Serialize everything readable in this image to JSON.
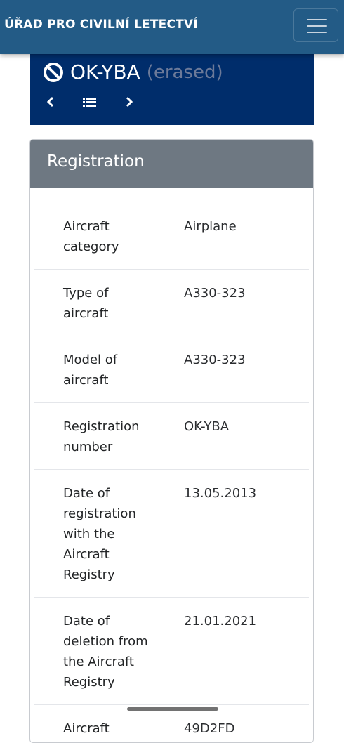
{
  "navbar": {
    "brand": "ÚŘAD PRO CIVILNÍ LETECTVÍ",
    "menu_icon": "hamburger-menu-icon"
  },
  "aircraft": {
    "registration": "OK-YBA",
    "status": "(erased)",
    "status_icon": "prohibited-icon"
  },
  "nav": {
    "prev_icon": "chevron-left-icon",
    "list_icon": "list-icon",
    "next_icon": "chevron-right-icon"
  },
  "registration_card": {
    "title": "Registration",
    "rows": [
      {
        "label": "Aircraft category",
        "value": "Airplane"
      },
      {
        "label": "Type of aircraft",
        "value": "A330-323"
      },
      {
        "label": "Model of aircraft",
        "value": "A330-323"
      },
      {
        "label": "Registration number",
        "value": "OK-YBA"
      },
      {
        "label": "Date of registration with the Aircraft Registry",
        "value": "13.05.2013"
      },
      {
        "label": "Date of deletion from the Aircraft Registry",
        "value": "21.01.2021"
      },
      {
        "label": "Aircraft (transponder)",
        "value": "49D2FD"
      }
    ]
  },
  "colors": {
    "navbar": "#235b86",
    "header_box": "#002d6b",
    "card_header": "#6e7882",
    "erased_text": "#6c7a99"
  }
}
